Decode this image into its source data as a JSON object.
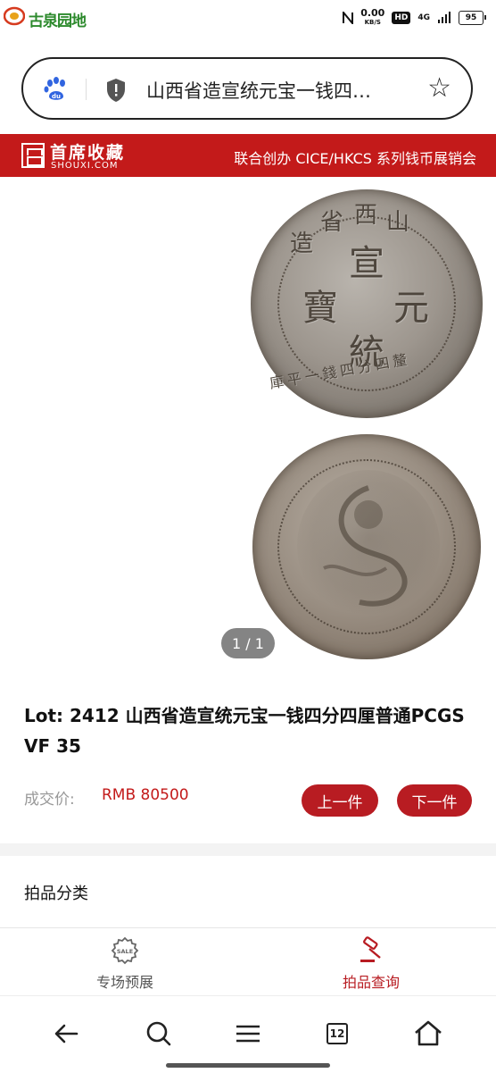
{
  "status": {
    "watermark": "古泉园地",
    "speed_value": "0.00",
    "speed_unit": "KB/S",
    "hd": "HD",
    "network": "4G",
    "battery": "95"
  },
  "address_bar": {
    "url_text": "山西省造宣统元宝一钱四…"
  },
  "banner": {
    "brand_cn": "首席收藏",
    "brand_en": "SHOUXI.COM",
    "tagline": "联合创办 CICE/HKCS 系列钱币展销会"
  },
  "coin_obverse": {
    "top_chars": [
      "山",
      "西",
      "省",
      "造"
    ],
    "center_chars": [
      "宣",
      "元",
      "統",
      "寶"
    ],
    "bottom_text": "庫平一錢四分四釐"
  },
  "gallery": {
    "pager": "1 / 1"
  },
  "lot": {
    "title": "Lot: 2412 山西省造宣统元宝一钱四分四厘普通PCGS VF 35",
    "price_label": "成交价:",
    "price_value": "RMB 80500",
    "prev_label": "上一件",
    "next_label": "下一件"
  },
  "section": {
    "category_label": "拍品分类"
  },
  "app_tabs": [
    {
      "label": "专场预展",
      "icon": "sale-tag-icon"
    },
    {
      "label": "拍品查询",
      "icon": "gavel-icon"
    }
  ],
  "browser_nav": {
    "tab_count": "12"
  },
  "colors": {
    "brand_red": "#c31a1a",
    "button_red": "#b81c22",
    "price_red": "#c31a1a"
  }
}
